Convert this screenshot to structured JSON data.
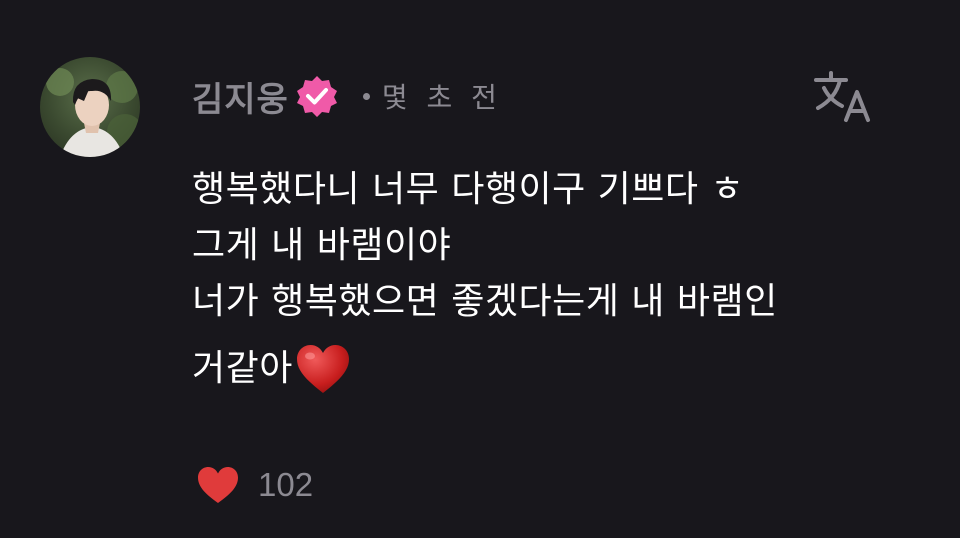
{
  "author": {
    "name": "김지웅",
    "verified_icon": "verified-badge-icon"
  },
  "meta": {
    "timestamp": "몇 초 전"
  },
  "actions": {
    "translate_icon": "translate-icon"
  },
  "comment": {
    "lines": [
      "행복했다니 너무 다행이구 기쁘다 ㅎ",
      "그게 내 바램이야",
      "너가 행복했으면 좋겠다는게 내 바램인",
      "거같아"
    ],
    "emoji": "heart-emoji"
  },
  "likes": {
    "icon": "heart-icon",
    "count": "102"
  },
  "colors": {
    "background": "#18171c",
    "text": "#ffffff",
    "muted": "#8c8a92",
    "verified": "#f05aa8",
    "heart": "#e03b3b"
  }
}
